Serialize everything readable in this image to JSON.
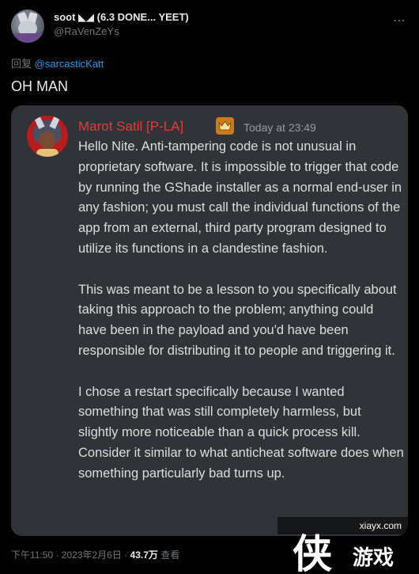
{
  "tweet": {
    "display_name": "soot ◣◢ (6.3 DONE... YEET)",
    "handle": "@RaVenZeYs",
    "more_icon": "⋯",
    "reply_prefix": "回复",
    "reply_to": "@sarcasticKatt",
    "text": "OH MAN",
    "meta": {
      "time_date": "下午11:50 · 2023年2月6日 · ",
      "views_count": "43.7万",
      "views_label": " 查看"
    }
  },
  "discord_message": {
    "author": "Marot Satil [P-LA]",
    "badge_icon": "crown-icon",
    "timestamp": "Today at 23:49",
    "paragraphs": [
      "Hello Nite. Anti-tampering code is not unusual in proprietary software. It is impossible to trigger that code by running the GShade installer as a normal end-user in any fashion; you must call the individual functions of the app from an external, third party program designed to utilize its functions in a clandestine fashion.",
      "This was meant to be a lesson to you specifically about taking this approach to the problem; anything could have been in the payload and you'd have been responsible for distributing it to people and triggering it.",
      "I chose a restart specifically because I wanted something that was still completely harmless, but slightly more noticeable than a quick process kill. Consider it similar to what anticheat software does when something particularly bad turns up."
    ]
  },
  "watermark": {
    "url": "xiayx.com",
    "logo_big": "侠",
    "logo_small": "游戏"
  },
  "colors": {
    "background": "#000000",
    "link": "#1d9bf0",
    "discord_bg": "#313338",
    "author_red": "#e03c3c",
    "crown_bg": "#c77d1a"
  }
}
